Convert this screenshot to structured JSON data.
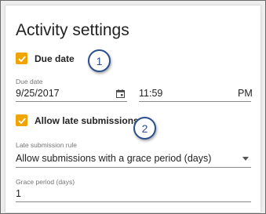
{
  "panel": {
    "title": "Activity settings"
  },
  "due_date": {
    "checkbox_label": "Due date",
    "checked": true,
    "date_label": "Due date",
    "date_value": "9/25/2017",
    "time_value": "11:59",
    "ampm_value": "PM"
  },
  "late_submissions": {
    "checkbox_label": "Allow late submissions",
    "checked": true,
    "rule_label": "Late submission rule",
    "rule_value": "Allow submissions with a grace period (days)",
    "grace_label": "Grace period (days)",
    "grace_value": "1"
  },
  "callouts": [
    "1",
    "2"
  ],
  "colors": {
    "checkbox": "#f0a400",
    "callout": "#2b4f8c"
  },
  "icons": {
    "calendar": "calendar-icon",
    "dropdown": "chevron-down-icon",
    "check": "checkmark-icon"
  }
}
